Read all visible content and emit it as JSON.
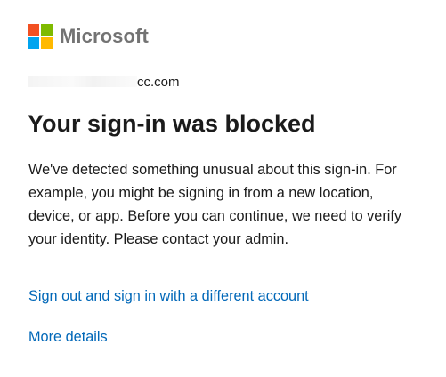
{
  "brand": {
    "name": "Microsoft",
    "colors": {
      "red": "#f25022",
      "green": "#7fba00",
      "blue": "#00a4ef",
      "yellow": "#ffb900"
    }
  },
  "account": {
    "visible_suffix": "cc.com"
  },
  "title": "Your sign-in was blocked",
  "description": "We've detected something unusual about this sign-in. For example, you might be signing in from a new location, device, or app. Before you can continue, we need to verify your identity. Please contact your admin.",
  "links": {
    "switch_account": "Sign out and sign in with a different account",
    "more_details": "More details"
  },
  "accent_color": "#0067b8"
}
